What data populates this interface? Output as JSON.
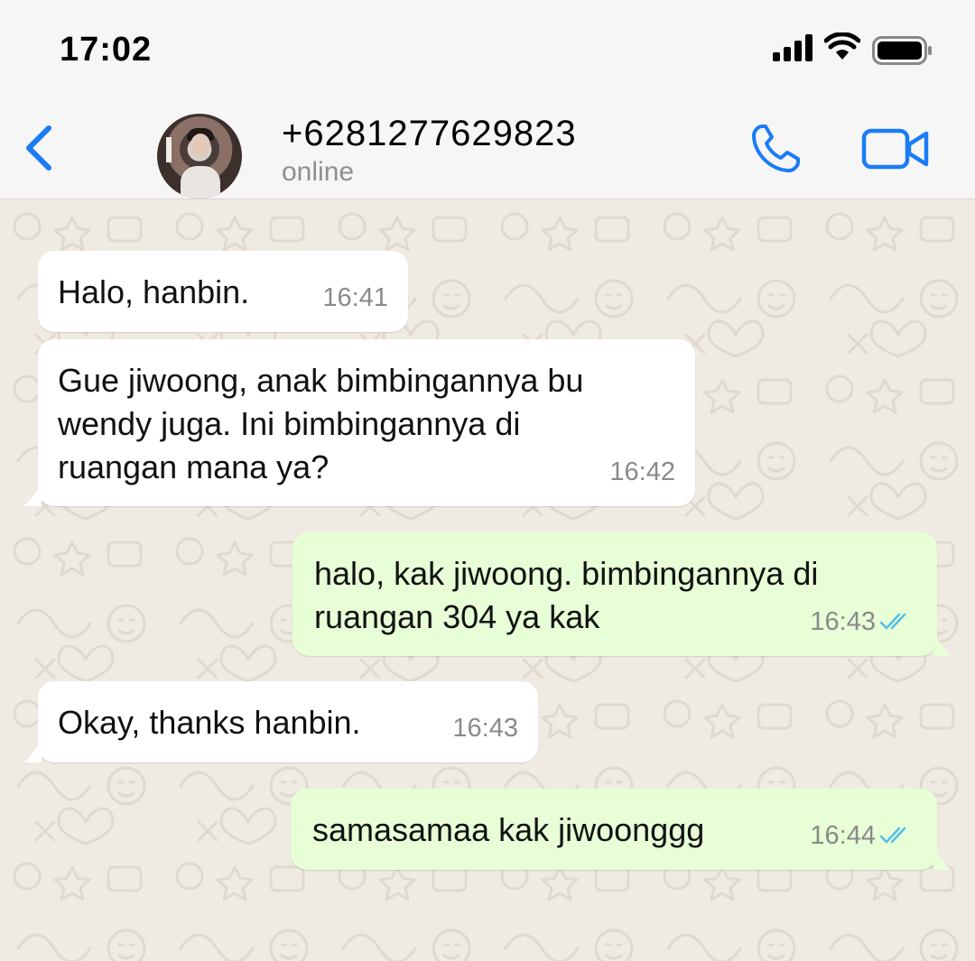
{
  "status_bar": {
    "time": "17:02"
  },
  "header": {
    "contact_name": "+6281277629823",
    "contact_status": "online"
  },
  "messages": [
    {
      "direction": "incoming",
      "text": "Halo, hanbin.",
      "time": "16:41"
    },
    {
      "direction": "incoming",
      "text": "Gue jiwoong, anak bimbingannya bu\nwendy juga. Ini bimbingannya di\nruangan mana ya?",
      "time": "16:42"
    },
    {
      "direction": "outgoing",
      "text": "halo, kak jiwoong. bimbingannya di\nruangan 304 ya kak",
      "time": "16:43",
      "read": true
    },
    {
      "direction": "incoming",
      "text": "Okay, thanks hanbin.",
      "time": "16:43"
    },
    {
      "direction": "outgoing",
      "text": "samasamaa kak jiwoonggg",
      "time": "16:44",
      "read": true
    }
  ],
  "colors": {
    "accent": "#1a7cf5",
    "incoming_bubble": "#ffffff",
    "outgoing_bubble": "#e7fed6",
    "read_ticks": "#53bdeb",
    "chat_background": "#efeae2"
  }
}
